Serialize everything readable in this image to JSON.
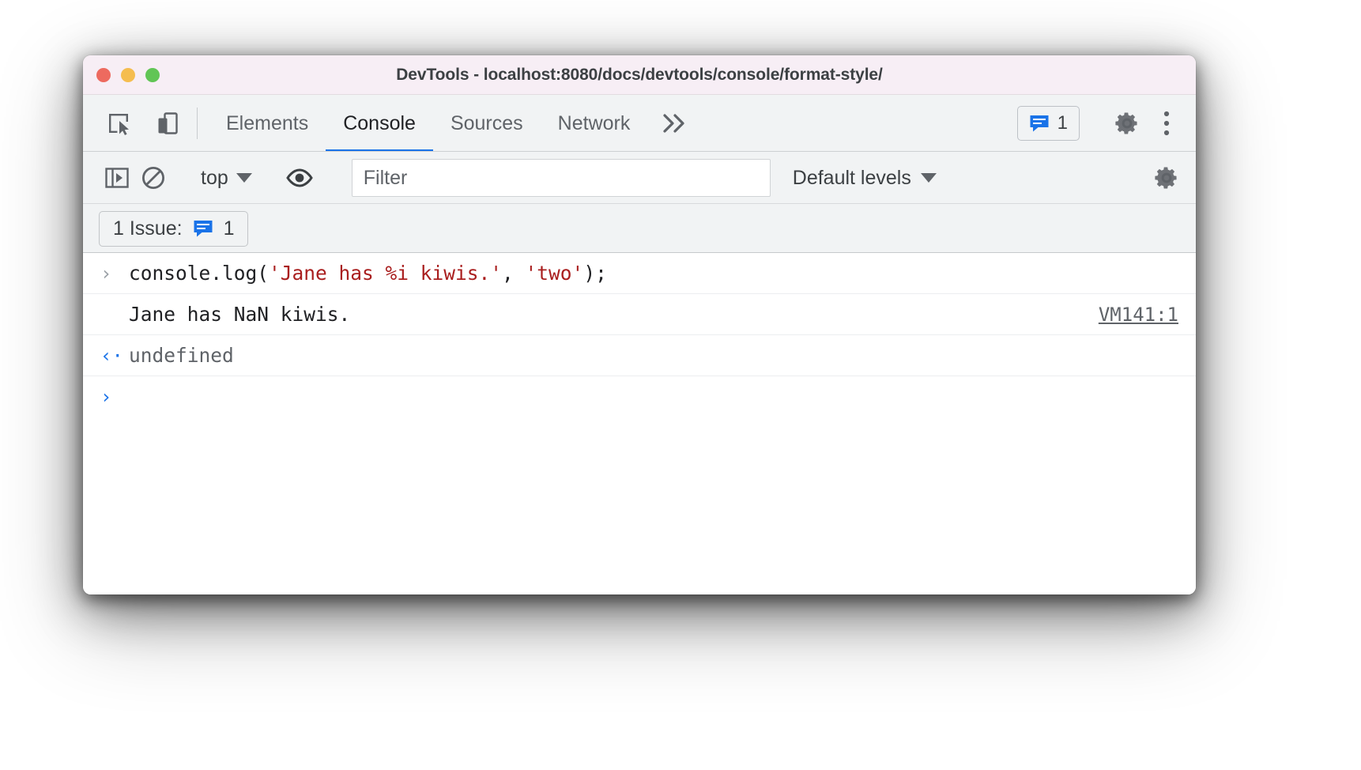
{
  "window": {
    "title": "DevTools - localhost:8080/docs/devtools/console/format-style/",
    "traffic_lights": {
      "close": "close-button",
      "minimize": "minimize-button",
      "maximize": "maximize-button"
    },
    "colors": {
      "titlebar_bg": "#f7eef5",
      "toolbar_bg": "#f1f3f4",
      "accent_blue": "#1a73e8",
      "string_red": "#a91e1e",
      "text_dark": "#202124",
      "text_muted": "#5f6368"
    }
  },
  "tabbar": {
    "inspect_icon": "inspect-element-icon",
    "device_icon": "device-toolbar-icon",
    "tabs": [
      {
        "label": "Elements",
        "active": false
      },
      {
        "label": "Console",
        "active": true
      },
      {
        "label": "Sources",
        "active": false
      },
      {
        "label": "Network",
        "active": false
      }
    ],
    "more_tabs_icon": "chevron-double-right-icon",
    "issues_badge": {
      "icon": "issues-message-icon",
      "count": "1"
    },
    "settings_icon": "gear-icon",
    "more_options_icon": "kebab-menu-icon"
  },
  "console_toolbar": {
    "sidebar_toggle_icon": "console-sidebar-icon",
    "clear_console_icon": "clear-console-icon",
    "context_selector": {
      "value": "top",
      "caret": "chevron-down-icon"
    },
    "live_expression_icon": "eye-icon",
    "filter": {
      "value": "",
      "placeholder": "Filter"
    },
    "levels": {
      "value": "Default levels",
      "caret": "chevron-down-icon"
    },
    "settings_icon": "gear-icon"
  },
  "issues_bar": {
    "label": "1 Issue:",
    "icon": "issues-message-icon",
    "count": "1"
  },
  "console": {
    "rows": [
      {
        "type": "input",
        "gutter": "›",
        "segments": [
          {
            "text": "console.log(",
            "style": "plain"
          },
          {
            "text": "'Jane has %i kiwis.'",
            "style": "string"
          },
          {
            "text": ", ",
            "style": "plain"
          },
          {
            "text": "'two'",
            "style": "string"
          },
          {
            "text": ");",
            "style": "plain"
          }
        ],
        "source": ""
      },
      {
        "type": "output",
        "gutter": "",
        "text": "Jane has NaN kiwis.",
        "source": "VM141:1"
      },
      {
        "type": "result",
        "gutter": "‹·",
        "text": "undefined",
        "source": ""
      }
    ],
    "prompt": "›"
  }
}
